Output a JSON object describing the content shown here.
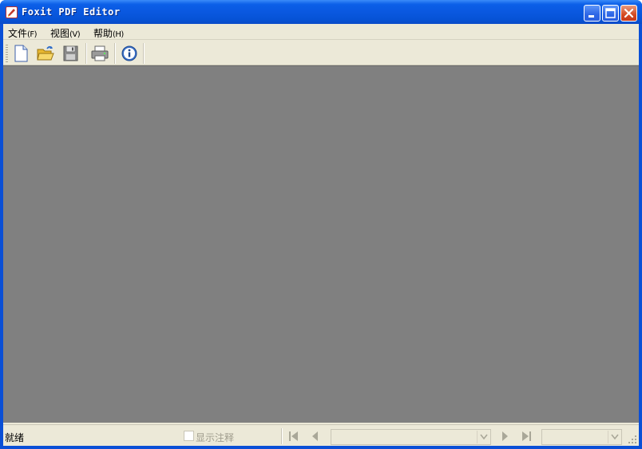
{
  "window": {
    "title": "Foxit PDF Editor"
  },
  "menu": {
    "items": [
      {
        "label": "文件",
        "mnemonic": "(F)"
      },
      {
        "label": "视图",
        "mnemonic": "(V)"
      },
      {
        "label": "帮助",
        "mnemonic": "(H)"
      }
    ]
  },
  "toolbar": {
    "icons": [
      "new-document-icon",
      "open-folder-icon",
      "save-disk-icon",
      "print-icon",
      "info-icon"
    ]
  },
  "status": {
    "text": "就绪",
    "show_annotations_label": "显示注释",
    "show_annotations_checked": false,
    "page_combo_value": "",
    "zoom_combo_value": ""
  },
  "colors": {
    "document_background": "#808080",
    "chrome": "#ece9d8",
    "title_bar": "#0a58e0"
  }
}
